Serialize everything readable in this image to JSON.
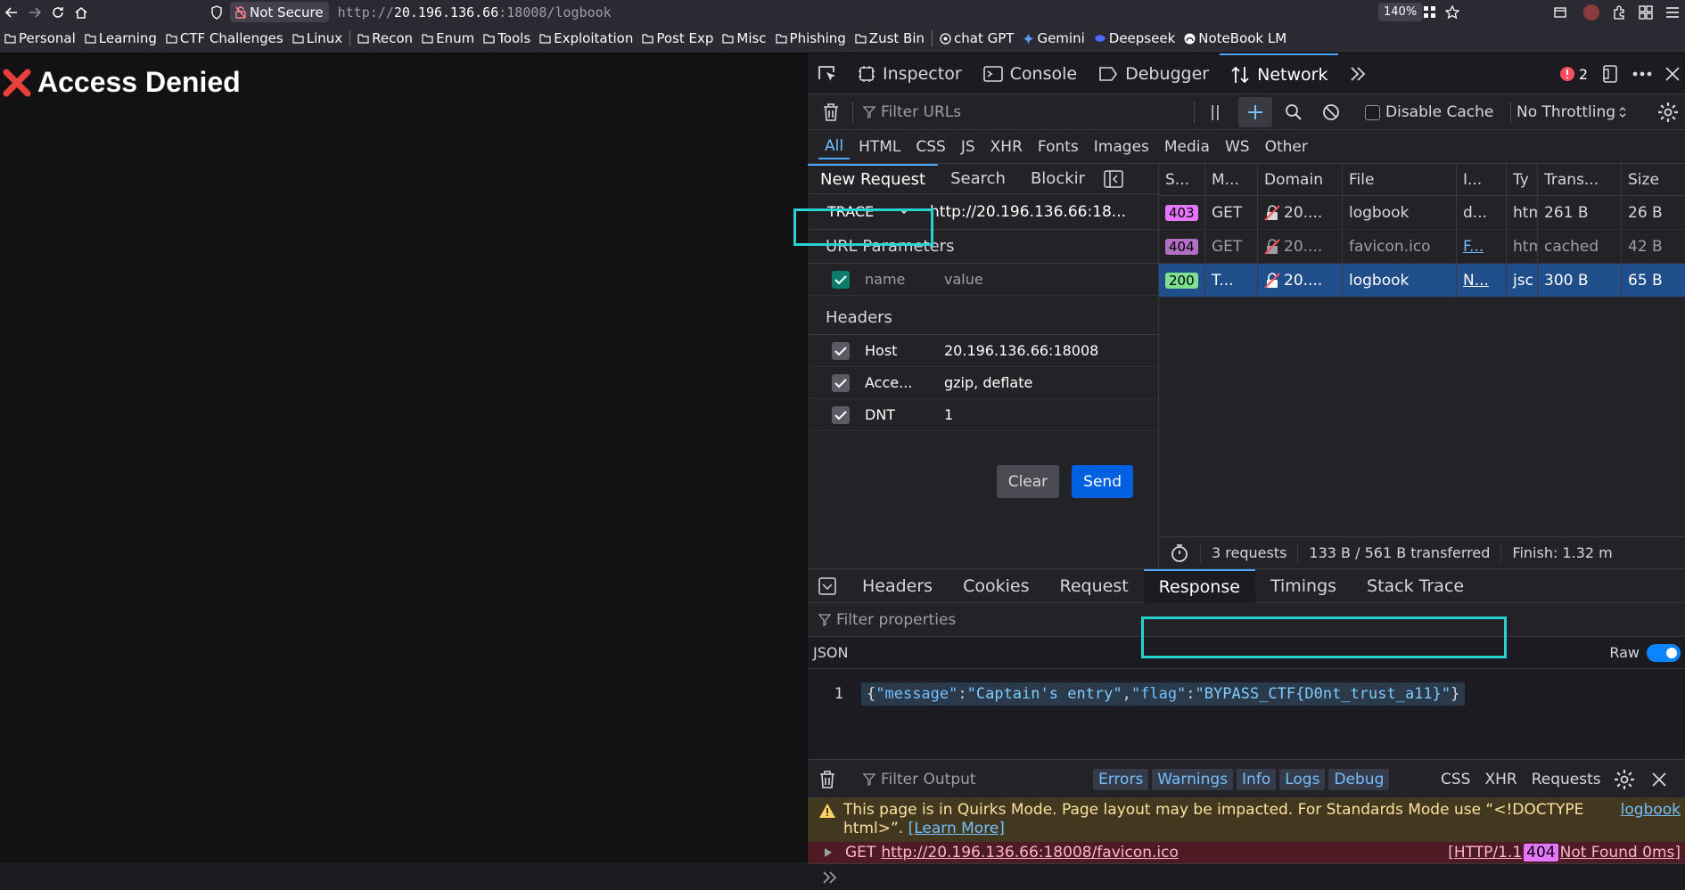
{
  "urlbar": {
    "not_secure": "Not Secure",
    "url_prefix": "http://",
    "url_host": "20.196.136.66",
    "url_rest": ":18008/logbook",
    "zoom": "140%"
  },
  "bookmarks": [
    {
      "label": "Personal"
    },
    {
      "label": "Learning"
    },
    {
      "label": "CTF Challenges"
    },
    {
      "label": "Linux"
    },
    {
      "label": "Recon"
    },
    {
      "label": "Enum"
    },
    {
      "label": "Tools"
    },
    {
      "label": "Exploitation"
    },
    {
      "label": "Post Exp"
    },
    {
      "label": "Misc"
    },
    {
      "label": "Phishing"
    },
    {
      "label": "Zust Bin"
    },
    {
      "label": "chat GPT"
    },
    {
      "label": "Gemini"
    },
    {
      "label": "Deepseek"
    },
    {
      "label": "NoteBook LM"
    }
  ],
  "page": {
    "heading": "Access Denied"
  },
  "devtools": {
    "tabs": [
      "Inspector",
      "Console",
      "Debugger",
      "Network"
    ],
    "error_count": "2",
    "net_filter_placeholder": "Filter URLs",
    "pause_label": "||",
    "disable_cache": "Disable Cache",
    "throttling": "No Throttling",
    "type_filters": [
      "All",
      "HTML",
      "CSS",
      "JS",
      "XHR",
      "Fonts",
      "Images",
      "Media",
      "WS",
      "Other"
    ],
    "request_tabs": [
      "New Request",
      "Search",
      "Blockir"
    ],
    "method": "TRACE",
    "request_url": "http://20.196.136.66:18...",
    "url_params_title": "URL Parameters",
    "param_name_placeholder": "name",
    "param_value_placeholder": "value",
    "headers_title": "Headers",
    "headers": [
      {
        "name": "Host",
        "value": "20.196.136.66:18008"
      },
      {
        "name": "Acce...",
        "value": "gzip, deflate"
      },
      {
        "name": "DNT",
        "value": "1"
      }
    ],
    "clear_label": "Clear",
    "send_label": "Send",
    "columns": [
      "S...",
      "M...",
      "Domain",
      "File",
      "I...",
      "Ty",
      "Trans...",
      "Size"
    ],
    "rows": [
      {
        "status": "403",
        "method": "GET",
        "domain": "20....",
        "file": "logbook",
        "initiator": "d...",
        "type": "htm",
        "transferred": "261 B",
        "size": "26 B"
      },
      {
        "status": "404",
        "method": "GET",
        "domain": "20....",
        "file": "favicon.ico",
        "initiator": "F...",
        "type": "htm",
        "transferred": "cached",
        "size": "42 B"
      },
      {
        "status": "200",
        "method": "T...",
        "domain": "20....",
        "file": "logbook",
        "initiator": "N...",
        "type": "jsc",
        "transferred": "300 B",
        "size": "65 B"
      }
    ],
    "summary": {
      "requests": "3 requests",
      "transferred": "133 B / 561 B transferred",
      "finish": "Finish: 1.32 m"
    },
    "detail_tabs": [
      "Headers",
      "Cookies",
      "Request",
      "Response",
      "Timings",
      "Stack Trace"
    ],
    "filter_properties": "Filter properties",
    "json_label": "JSON",
    "raw_label": "Raw",
    "line_number": "1",
    "json": {
      "open": "{",
      "k1": "\"message\"",
      "colon": ":",
      "v1": "\"Captain's entry\"",
      "comma": ",",
      "k2": "\"flag\"",
      "v2": "\"BYPASS_CTF{D0nt_trust_a11}\"",
      "close": "}"
    },
    "console": {
      "filter_placeholder": "Filter Output",
      "levels": [
        "Errors",
        "Warnings",
        "Info",
        "Logs",
        "Debug"
      ],
      "types": [
        "CSS",
        "XHR",
        "Requests"
      ],
      "warning_text": "This page is in Quirks Mode. Page layout may be impacted. For Standards Mode use “<!DOCTYPE html>”.",
      "learn_more": "[Learn More]",
      "warning_source": "logbook",
      "error_method": "GET",
      "error_url": "http://20.196.136.66:18008/favicon.ico",
      "error_proto": "[HTTP/1.1",
      "error_code": "404",
      "error_text": "Not Found 0ms]"
    }
  }
}
